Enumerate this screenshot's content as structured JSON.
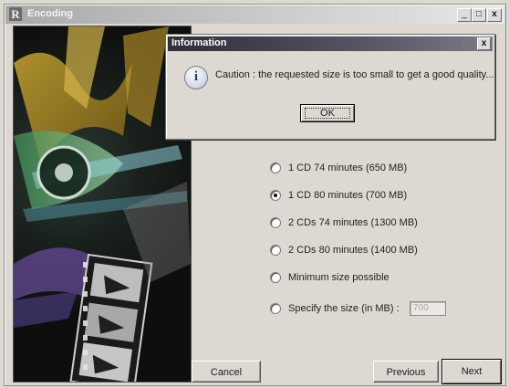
{
  "window": {
    "title": "Encoding",
    "logo_letter": "R",
    "controls": {
      "minimize": "_",
      "maximize": "□",
      "close": "x"
    }
  },
  "dialog": {
    "title": "Information",
    "close": "x",
    "icon": "info-icon",
    "icon_glyph": "i",
    "message": "Caution : the requested size is too small to get a good quality...",
    "ok_label": "OK"
  },
  "options": [
    {
      "label": "1 CD 74 minutes (650 MB)",
      "checked": false
    },
    {
      "label": "1 CD 80 minutes (700 MB)",
      "checked": true
    },
    {
      "label": "2 CDs 74 minutes (1300 MB)",
      "checked": false
    },
    {
      "label": "2 CDs 80 minutes (1400 MB)",
      "checked": false
    },
    {
      "label": "Minimum size possible",
      "checked": false
    },
    {
      "label": "Specify the size (in MB) :",
      "checked": false
    }
  ],
  "size_input": {
    "value": "700"
  },
  "buttons": {
    "cancel": "Cancel",
    "previous": "Previous",
    "next": "Next"
  }
}
